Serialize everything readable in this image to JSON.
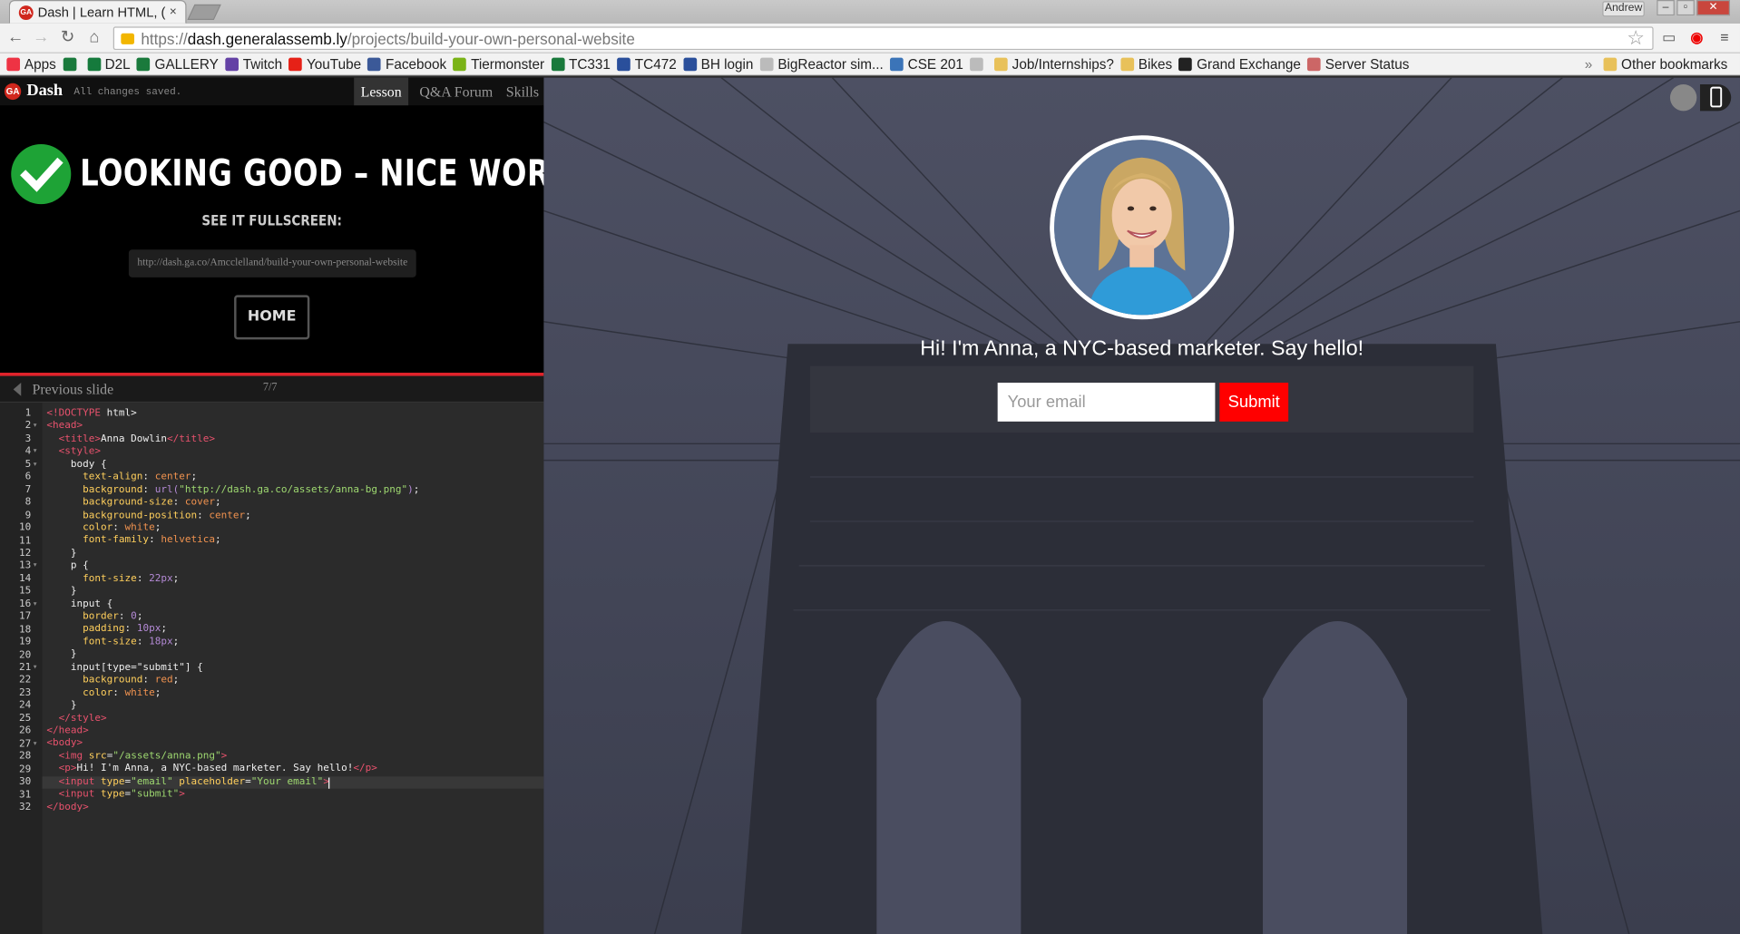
{
  "browser": {
    "tab_title": "Dash | Learn HTML, (",
    "tab_close": "×",
    "user": "Andrew",
    "window_buttons": [
      "–",
      "▫",
      "✕"
    ],
    "url_scheme": "https://",
    "url_host": "dash.generalassemb.ly",
    "url_path": "/projects/build-your-own-personal-website"
  },
  "bookmarks": {
    "items": [
      {
        "label": "Apps",
        "icon": "apps-grid-icon",
        "color": "#e34"
      },
      {
        "label": "",
        "icon": "ga-icon",
        "color": "#1a7a3c"
      },
      {
        "label": "D2L",
        "icon": "d2l-icon",
        "color": "#157a3c"
      },
      {
        "label": "GALLERY",
        "icon": "gallery-icon",
        "color": "#1a7a3c"
      },
      {
        "label": "Twitch",
        "icon": "twitch-icon",
        "color": "#6441a5"
      },
      {
        "label": "YouTube",
        "icon": "youtube-icon",
        "color": "#e62117"
      },
      {
        "label": "Facebook",
        "icon": "facebook-icon",
        "color": "#3b5998"
      },
      {
        "label": "Tiermonster",
        "icon": "tiermonster-icon",
        "color": "#7ab317"
      },
      {
        "label": "TC331",
        "icon": "spartan-icon",
        "color": "#1a7a3c"
      },
      {
        "label": "TC472",
        "icon": "grid-icon",
        "color": "#2a4f9b"
      },
      {
        "label": "BH login",
        "icon": "grid-icon",
        "color": "#2a4f9b"
      },
      {
        "label": "BigReactor sim...",
        "icon": "page-icon",
        "color": "#bbb"
      },
      {
        "label": "CSE 201",
        "icon": "p-icon",
        "color": "#3b74b8"
      },
      {
        "label": "",
        "icon": "page-icon",
        "color": "#bbb"
      },
      {
        "label": "Job/Internships?",
        "icon": "folder-icon",
        "color": "#e8c15a"
      },
      {
        "label": "Bikes",
        "icon": "folder-icon",
        "color": "#e8c15a"
      },
      {
        "label": "Grand Exchange",
        "icon": "runescape-icon",
        "color": "#222"
      },
      {
        "label": "Server Status",
        "icon": "server-icon",
        "color": "#c66"
      }
    ],
    "overflow": "»",
    "other": "Other bookmarks"
  },
  "dash": {
    "brand": "Dash",
    "logo": "GA",
    "status": "All changes saved.",
    "nav": [
      "Lesson",
      "Q&A Forum",
      "Skills"
    ]
  },
  "lesson": {
    "headline": "LOOKING GOOD – NICE WORK!",
    "see_fullscreen": "SEE IT FULLSCREEN:",
    "fullscreen_url": "http://dash.ga.co/Amcclelland/build-your-own-personal-website",
    "home_button": "HOME",
    "prev_slide": "Previous slide",
    "slide_count": "7/7"
  },
  "editor": {
    "active_line": 30,
    "lines": [
      [
        [
          "tag",
          "<!DOCTYPE"
        ],
        [
          "t",
          " html>"
        ]
      ],
      [
        [
          "tag",
          "<head>"
        ]
      ],
      [
        [
          "t",
          "  "
        ],
        [
          "tag",
          "<title>"
        ],
        [
          "t",
          "Anna Dowlin"
        ],
        [
          "tag",
          "</title>"
        ]
      ],
      [
        [
          "t",
          "  "
        ],
        [
          "tag",
          "<style>"
        ]
      ],
      [
        [
          "t",
          "    body {"
        ]
      ],
      [
        [
          "t",
          "      "
        ],
        [
          "prop",
          "text-align"
        ],
        [
          "t",
          ": "
        ],
        [
          "val",
          "center"
        ],
        [
          "t",
          ";"
        ]
      ],
      [
        [
          "t",
          "      "
        ],
        [
          "prop",
          "background"
        ],
        [
          "t",
          ": "
        ],
        [
          "num",
          "url("
        ],
        [
          "str",
          "\"http://dash.ga.co/assets/anna-bg.png\""
        ],
        [
          "num",
          ")"
        ],
        [
          "t",
          ";"
        ]
      ],
      [
        [
          "t",
          "      "
        ],
        [
          "prop",
          "background-size"
        ],
        [
          "t",
          ": "
        ],
        [
          "val",
          "cover"
        ],
        [
          "t",
          ";"
        ]
      ],
      [
        [
          "t",
          "      "
        ],
        [
          "prop",
          "background-position"
        ],
        [
          "t",
          ": "
        ],
        [
          "val",
          "center"
        ],
        [
          "t",
          ";"
        ]
      ],
      [
        [
          "t",
          "      "
        ],
        [
          "prop",
          "color"
        ],
        [
          "t",
          ": "
        ],
        [
          "val",
          "white"
        ],
        [
          "t",
          ";"
        ]
      ],
      [
        [
          "t",
          "      "
        ],
        [
          "prop",
          "font-family"
        ],
        [
          "t",
          ": "
        ],
        [
          "val",
          "helvetica"
        ],
        [
          "t",
          ";"
        ]
      ],
      [
        [
          "t",
          "    }"
        ]
      ],
      [
        [
          "t",
          "    p {"
        ]
      ],
      [
        [
          "t",
          "      "
        ],
        [
          "prop",
          "font-size"
        ],
        [
          "t",
          ": "
        ],
        [
          "num",
          "22px"
        ],
        [
          "t",
          ";"
        ]
      ],
      [
        [
          "t",
          "    }"
        ]
      ],
      [
        [
          "t",
          "    input {"
        ]
      ],
      [
        [
          "t",
          "      "
        ],
        [
          "prop",
          "border"
        ],
        [
          "t",
          ": "
        ],
        [
          "num",
          "0"
        ],
        [
          "t",
          ";"
        ]
      ],
      [
        [
          "t",
          "      "
        ],
        [
          "prop",
          "padding"
        ],
        [
          "t",
          ": "
        ],
        [
          "num",
          "10px"
        ],
        [
          "t",
          ";"
        ]
      ],
      [
        [
          "t",
          "      "
        ],
        [
          "prop",
          "font-size"
        ],
        [
          "t",
          ": "
        ],
        [
          "num",
          "18px"
        ],
        [
          "t",
          ";"
        ]
      ],
      [
        [
          "t",
          "    }"
        ]
      ],
      [
        [
          "t",
          "    input[type=\"submit\"] {"
        ]
      ],
      [
        [
          "t",
          "      "
        ],
        [
          "prop",
          "background"
        ],
        [
          "t",
          ": "
        ],
        [
          "val",
          "red"
        ],
        [
          "t",
          ";"
        ]
      ],
      [
        [
          "t",
          "      "
        ],
        [
          "prop",
          "color"
        ],
        [
          "t",
          ": "
        ],
        [
          "val",
          "white"
        ],
        [
          "t",
          ";"
        ]
      ],
      [
        [
          "t",
          "    }"
        ]
      ],
      [
        [
          "t",
          "  "
        ],
        [
          "tag",
          "</style>"
        ]
      ],
      [
        [
          "tag",
          "</head>"
        ]
      ],
      [
        [
          "tag",
          "<body>"
        ]
      ],
      [
        [
          "t",
          "  "
        ],
        [
          "tag",
          "<img"
        ],
        [
          "prop",
          " src"
        ],
        [
          "t",
          "="
        ],
        [
          "str",
          "\"/assets/anna.png\""
        ],
        [
          "tag",
          ">"
        ]
      ],
      [
        [
          "t",
          "  "
        ],
        [
          "tag",
          "<p>"
        ],
        [
          "t",
          "Hi! I'm Anna, a NYC-based marketer. Say hello!"
        ],
        [
          "tag",
          "</p>"
        ]
      ],
      [
        [
          "t",
          "  "
        ],
        [
          "tag",
          "<input"
        ],
        [
          "prop",
          " type"
        ],
        [
          "t",
          "="
        ],
        [
          "str",
          "\"email\""
        ],
        [
          "prop",
          " placeholder"
        ],
        [
          "t",
          "="
        ],
        [
          "str",
          "\"Your email\""
        ],
        [
          "tag",
          ">"
        ]
      ],
      [
        [
          "t",
          "  "
        ],
        [
          "tag",
          "<input"
        ],
        [
          "prop",
          " type"
        ],
        [
          "t",
          "="
        ],
        [
          "str",
          "\"submit\""
        ],
        [
          "tag",
          ">"
        ]
      ],
      [
        [
          "tag",
          "</body>"
        ]
      ]
    ],
    "fold_lines": [
      2,
      4,
      5,
      13,
      16,
      21,
      27
    ]
  },
  "preview": {
    "greeting": "Hi! I'm Anna, a NYC-based marketer. Say hello!",
    "email_placeholder": "Your email",
    "submit_label": "Submit",
    "background_color": "#3a3d4d"
  }
}
